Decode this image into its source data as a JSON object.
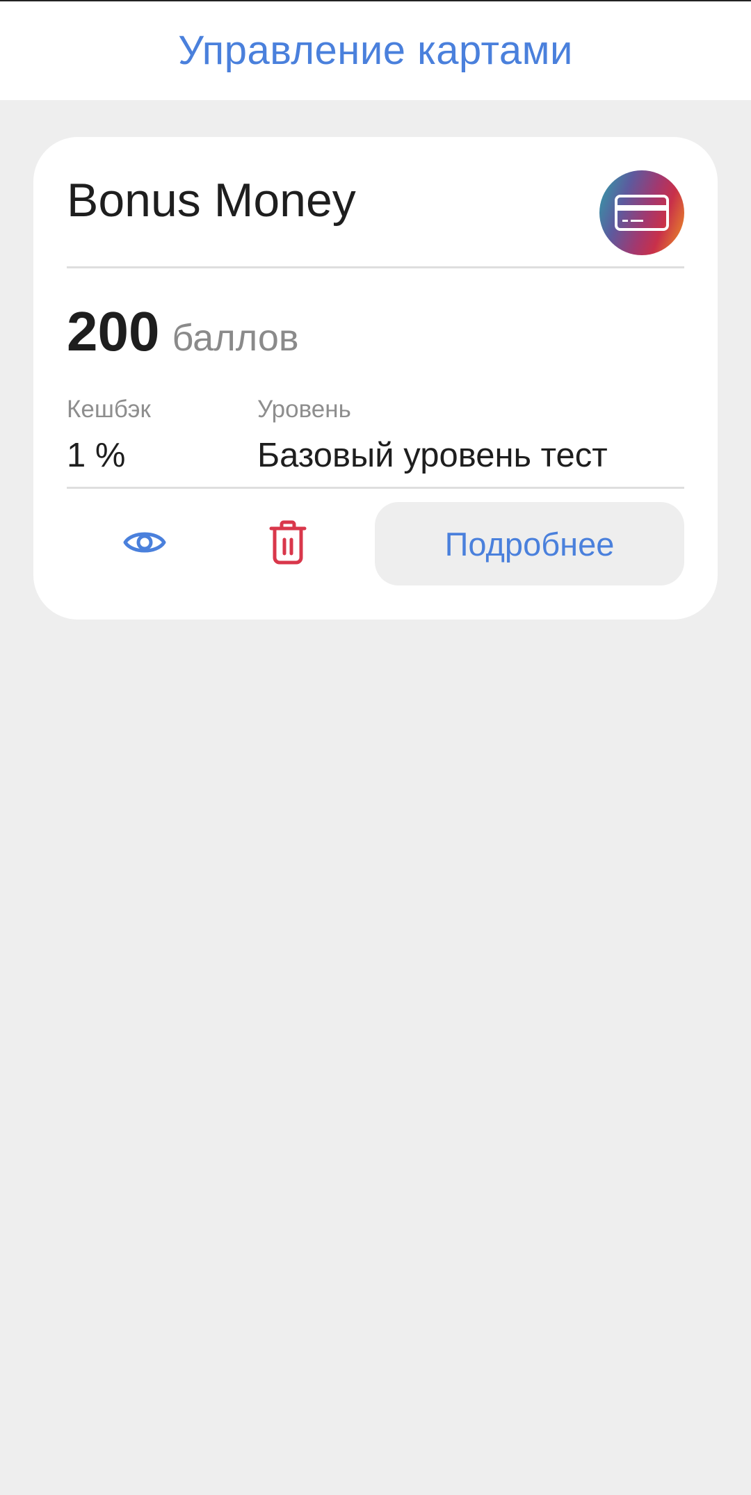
{
  "header": {
    "title": "Управление картами"
  },
  "card": {
    "name": "Bonus Money",
    "icon": "credit-card-icon",
    "balance": {
      "value": "200",
      "unit": "баллов"
    },
    "cashback": {
      "label": "Кешбэк",
      "value": "1 %"
    },
    "level": {
      "label": "Уровень",
      "value": "Базовый уровень тест"
    },
    "actions": {
      "view_icon": "eye-icon",
      "delete_icon": "trash-icon",
      "details_label": "Подробнее"
    }
  },
  "colors": {
    "accent": "#4a80dc",
    "danger": "#d9374b",
    "background": "#eeeeee",
    "card": "#ffffff"
  }
}
